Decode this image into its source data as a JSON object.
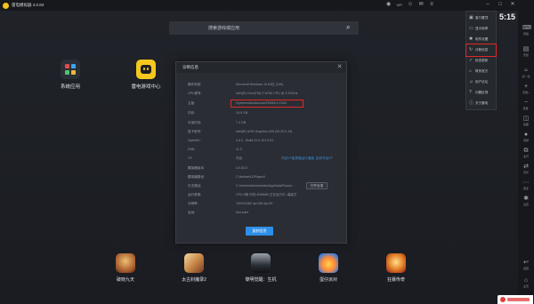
{
  "titlebar": {
    "title": "雷电模拟器 4.0.83",
    "vip": "VIP"
  },
  "status": {
    "time": "5:15"
  },
  "search": {
    "placeholder": "搜索游戏或应用"
  },
  "desktop": {
    "apps": [
      {
        "label": "系统应用"
      },
      {
        "label": "雷电游戏中心"
      }
    ]
  },
  "dialog": {
    "title": "诊断信息",
    "rows": [
      {
        "key": "操作系统:",
        "value": "Microsoft Windows 10 64位 (19h)"
      },
      {
        "key": "CPU型号:",
        "value": "Intel(R) Core(TM) i7-8700 CPU @ 3.20GHz"
      },
      {
        "key": "主板:",
        "value": "SystemmanufacturerZ390M-K-DUN"
      },
      {
        "key": "内存:",
        "value": "15.9 GB"
      },
      {
        "key": "可用内存:",
        "value": "7.4 GB"
      },
      {
        "key": "显卡型号:",
        "value": "Intel(R) UHD Graphics 630 (26.20.0.19)"
      },
      {
        "key": "OpenGL:",
        "value": "4.6.0 - Build 31.0.101.2111"
      },
      {
        "key": "D3D:",
        "value": "11.0"
      },
      {
        "key": "VT:",
        "value": "开启"
      },
      {
        "key": "模拟器版本:",
        "value": "4.0.83.0"
      },
      {
        "key": "模拟器路径:",
        "value": "C:/leidian/LDPlayer4"
      },
      {
        "key": "日志路径:",
        "value": "C:\\Users\\Administrator\\AppData\\Roami..."
      },
      {
        "key": "运行参数:",
        "value": "CPU:4核 内存:4096MB 正在运行中, 高级方"
      },
      {
        "key": "分辨率:",
        "value": "1920x1080 dpi 280 fps 60"
      },
      {
        "key": "启动:",
        "value": "first start"
      }
    ],
    "vt_link": "开启VT能提高运行速度, 如何开启VT",
    "open_button": "打开目录",
    "copy_button": "复制信息"
  },
  "menu": {
    "items": [
      {
        "icon": "screen-icon",
        "label": "窗口置顶"
      },
      {
        "icon": "display-icon",
        "label": "显示帧率"
      },
      {
        "icon": "gear-icon",
        "label": "软件设置"
      },
      {
        "icon": "refresh-icon",
        "label": "诊断信息"
      },
      {
        "icon": "check-icon",
        "label": "检查更新"
      },
      {
        "icon": "home-icon",
        "label": "联系官方"
      },
      {
        "icon": "user-icon",
        "label": "用户论坛"
      },
      {
        "icon": "help-icon",
        "label": "问题反馈"
      },
      {
        "icon": "info-icon",
        "label": "关于雷电"
      }
    ]
  },
  "rail": {
    "items": [
      {
        "icon": "keyboard-icon",
        "label": "键盘"
      },
      {
        "icon": "apk-icon",
        "label": "安装"
      },
      {
        "icon": "shake-icon",
        "label": "摇一摇"
      },
      {
        "icon": "volume-up-icon",
        "label": "音量+"
      },
      {
        "icon": "volume-down-icon",
        "label": "音量-"
      },
      {
        "icon": "screenshot-icon",
        "label": "截图"
      },
      {
        "icon": "record-icon",
        "label": "录屏"
      },
      {
        "icon": "multi-icon",
        "label": "多开"
      },
      {
        "icon": "sync-icon",
        "label": "同步"
      },
      {
        "icon": "more-icon",
        "label": "更多"
      },
      {
        "icon": "settings-icon",
        "label": "设置"
      },
      {
        "icon": "back-icon",
        "label": "返回"
      },
      {
        "icon": "home-icon",
        "label": "主页"
      }
    ]
  },
  "games": [
    {
      "label": "破晓九天"
    },
    {
      "label": "太古封魔录2"
    },
    {
      "label": "黎明觉醒：生机"
    },
    {
      "label": "蛋仔派对"
    },
    {
      "label": "狂暴传奇"
    }
  ],
  "colors": {
    "accent": "#2d8fe8",
    "highlight": "#e0282a",
    "brand_yellow": "#f6c71c"
  }
}
